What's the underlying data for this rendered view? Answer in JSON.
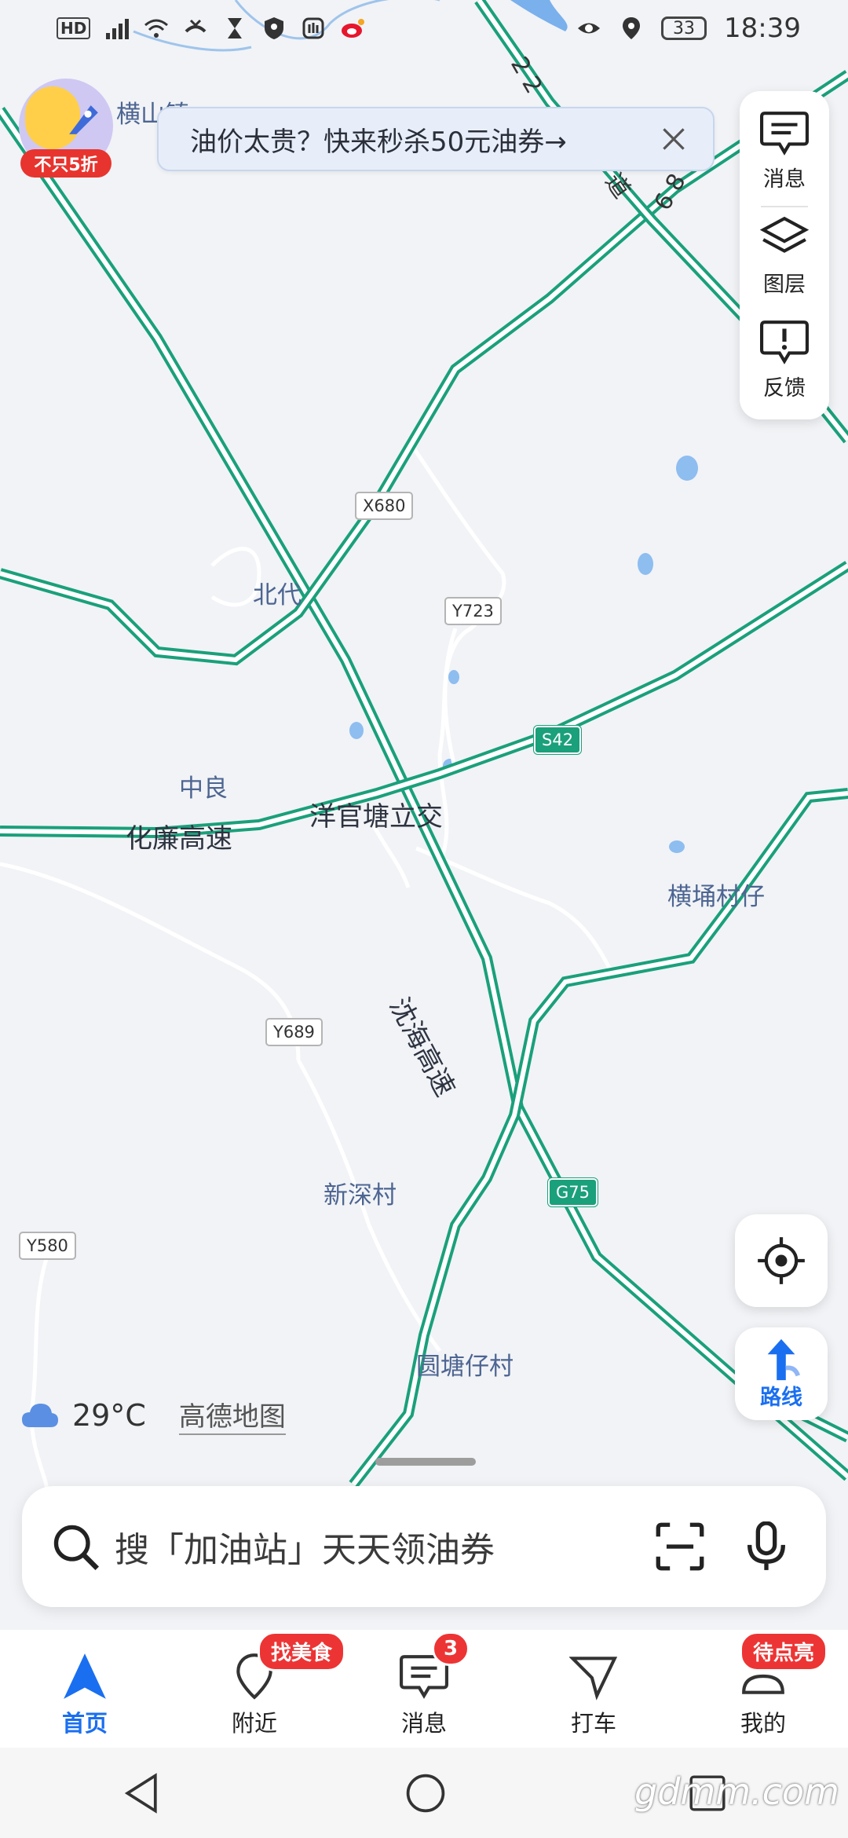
{
  "status_bar": {
    "left_icons": [
      "hd-icon",
      "4g-signal-icon",
      "wifi-icon",
      "missed-call-icon",
      "hourglass-icon",
      "shield-icon",
      "hand-icon",
      "weibo-icon"
    ],
    "hd": "HD",
    "battery": "33",
    "time": "18:39"
  },
  "promo": {
    "badge": "不只5折"
  },
  "banner": {
    "text": "油价太贵？快来秒杀50元油券→"
  },
  "side_panel": {
    "items": [
      {
        "label": "消息",
        "icon": "message-icon"
      },
      {
        "label": "图层",
        "icon": "layers-icon"
      },
      {
        "label": "反馈",
        "icon": "feedback-icon"
      }
    ]
  },
  "map": {
    "places": {
      "hengshanzhen": "横山镇",
      "beidai": "北代",
      "zhongliang": "中良",
      "yangguantang": "洋官塘立交",
      "huaLian": "化廉高速",
      "hengyong": "横埇村仔",
      "shenhai": "沈海高速",
      "xinshen": "新深村",
      "yuantang": "圆塘仔村"
    },
    "shields": {
      "x680": "X680",
      "y723": "Y723",
      "s42": "S42",
      "y689": "Y689",
      "g75": "G75",
      "y580": "Y580"
    }
  },
  "weather": {
    "temperature": "29°C",
    "logo": "高德地图"
  },
  "route_button": {
    "label": "路线"
  },
  "search": {
    "placeholder": "搜「加油站」天天领油券"
  },
  "bottom_nav": {
    "items": [
      {
        "label": "首页",
        "badge": "",
        "active": true
      },
      {
        "label": "附近",
        "badge": "找美食"
      },
      {
        "label": "消息",
        "badge": "3"
      },
      {
        "label": "打车",
        "badge": ""
      },
      {
        "label": "我的",
        "badge": "待点亮"
      }
    ]
  },
  "watermark": "gdmm.com",
  "colors": {
    "accent": "#1a6ff0",
    "highway": "#1aa07b",
    "badge": "#ed3434"
  }
}
